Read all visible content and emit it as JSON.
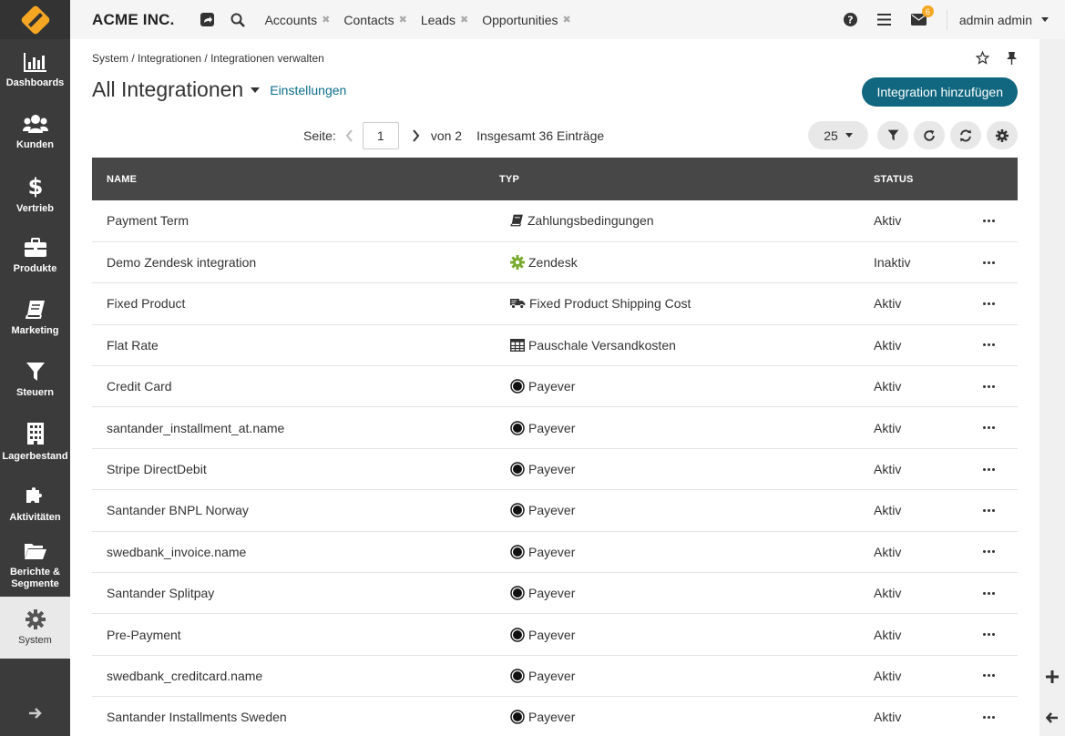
{
  "topbar": {
    "brand": "ACME INC.",
    "tabs": [
      {
        "label": "Accounts",
        "close": "✖"
      },
      {
        "label": "Contacts",
        "close": "✖"
      },
      {
        "label": "Leads",
        "close": "✖"
      },
      {
        "label": "Opportunities",
        "close": "✖"
      }
    ],
    "notification_count": "6",
    "user": "admin admin"
  },
  "sidebar": {
    "items": [
      {
        "label": "Dashboards",
        "icon": "bar-chart-icon"
      },
      {
        "label": "Kunden",
        "icon": "users-icon"
      },
      {
        "label": "Vertrieb",
        "icon": "dollar-icon"
      },
      {
        "label": "Produkte",
        "icon": "briefcase-icon"
      },
      {
        "label": "Marketing",
        "icon": "book-icon"
      },
      {
        "label": "Steuern",
        "icon": "filter-icon"
      },
      {
        "label": "Lagerbestand",
        "icon": "building-icon"
      },
      {
        "label": "Aktivitäten",
        "icon": "puzzle-icon"
      },
      {
        "label": "Berichte & Segmente",
        "icon": "folder-icon"
      },
      {
        "label": "System",
        "icon": "gear-icon"
      }
    ]
  },
  "breadcrumb": "System / Integrationen / Integrationen verwalten",
  "title": "All Integrationen",
  "settings_link": "Einstellungen",
  "add_button": "Integration hinzufügen",
  "pager": {
    "page_label": "Seite:",
    "current_page": "1",
    "of_label": "von 2",
    "total_label": "Insgesamt 36 Einträge",
    "per_page": "25"
  },
  "table": {
    "columns": [
      "NAME",
      "TYP",
      "STATUS"
    ],
    "rows": [
      {
        "name": "Payment Term",
        "type": "Zahlungsbedingungen",
        "type_icon": "book-icon",
        "status": "Aktiv"
      },
      {
        "name": "Demo Zendesk integration",
        "type": "Zendesk",
        "type_icon": "zendesk-icon",
        "status": "Inaktiv"
      },
      {
        "name": "Fixed Product",
        "type": "Fixed Product Shipping Cost",
        "type_icon": "truck-icon",
        "status": "Aktiv"
      },
      {
        "name": "Flat Rate",
        "type": "Pauschale Versandkosten",
        "type_icon": "table-icon",
        "status": "Aktiv"
      },
      {
        "name": "Credit Card",
        "type": "Payever",
        "type_icon": "payever-icon",
        "status": "Aktiv"
      },
      {
        "name": "santander_installment_at.name",
        "type": "Payever",
        "type_icon": "payever-icon",
        "status": "Aktiv"
      },
      {
        "name": "Stripe DirectDebit",
        "type": "Payever",
        "type_icon": "payever-icon",
        "status": "Aktiv"
      },
      {
        "name": "Santander BNPL Norway",
        "type": "Payever",
        "type_icon": "payever-icon",
        "status": "Aktiv"
      },
      {
        "name": "swedbank_invoice.name",
        "type": "Payever",
        "type_icon": "payever-icon",
        "status": "Aktiv"
      },
      {
        "name": "Santander Splitpay",
        "type": "Payever",
        "type_icon": "payever-icon",
        "status": "Aktiv"
      },
      {
        "name": "Pre-Payment",
        "type": "Payever",
        "type_icon": "payever-icon",
        "status": "Aktiv"
      },
      {
        "name": "swedbank_creditcard.name",
        "type": "Payever",
        "type_icon": "payever-icon",
        "status": "Aktiv"
      },
      {
        "name": "Santander Installments Sweden",
        "type": "Payever",
        "type_icon": "payever-icon",
        "status": "Aktiv"
      }
    ]
  },
  "colors": {
    "sidebar_bg": "#3b3b3b",
    "accent": "#10677f",
    "link": "#0c6e8c",
    "table_header_bg": "#474747",
    "badge": "#f5a623"
  }
}
